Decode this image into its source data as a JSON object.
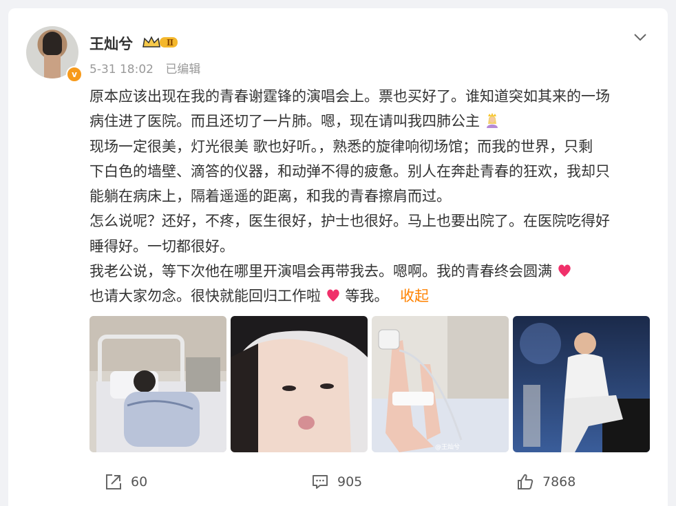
{
  "user": {
    "name": "王灿兮",
    "time": "5-31 18:02",
    "edited": "已编辑",
    "level_badge": "Ⅱ"
  },
  "post": {
    "lines": [
      "原本应该出现在我的青春谢霆锋的演唱会上。票也买好了。谁知道突如其来的一场",
      "病住进了医院。而且还切了一片肺。嗯，现在请叫我四肺公主",
      "现场一定很美，灯光很美 歌也好听。，熟悉的旋律响彻场馆；而我的世界，只剩",
      "下白色的墙壁、滴答的仪器，和动弹不得的疲惫。别人在奔赴青春的狂欢，我却只",
      "能躺在病床上，隔着遥遥的距离，和我的青春擦肩而过。",
      "怎么说呢？还好，不疼，医生很好，护士也很好。马上也要出院了。在医院吃得好",
      "睡得好。一切都很好。",
      "我老公说，等下次他在哪里开演唱会再带我去。嗯啊。我的青春终会圆满",
      "也请大家勿念。很快就能回归工作啦",
      "等我。"
    ],
    "collapse_label": "收起"
  },
  "images": [
    {
      "alt": "hospital-bed-photo"
    },
    {
      "alt": "selfie-photo"
    },
    {
      "alt": "iv-hand-photo",
      "watermark": "@王灿兮"
    },
    {
      "alt": "concert-photo"
    }
  ],
  "footer": {
    "share_count": "60",
    "comment_count": "905",
    "like_count": "7868"
  },
  "colors": {
    "accent": "#ff8200",
    "text": "#333333",
    "muted": "#999999"
  }
}
